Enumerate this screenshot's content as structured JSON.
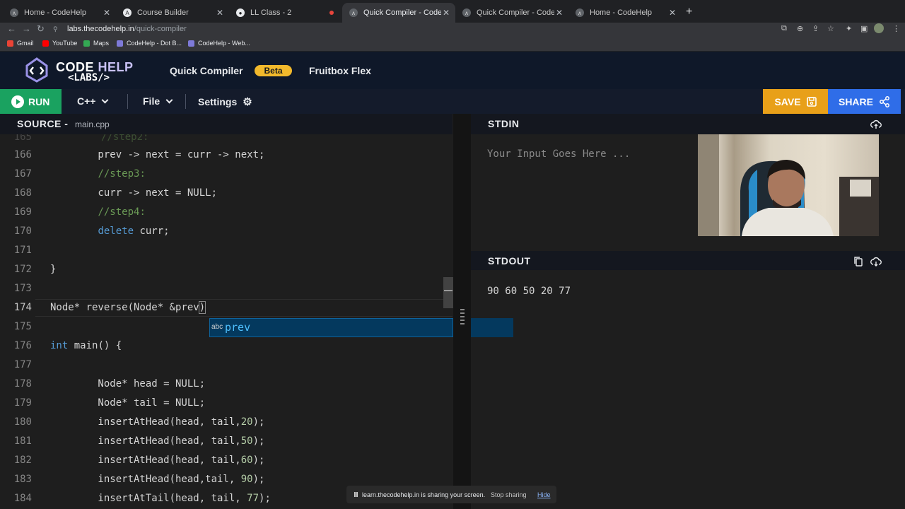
{
  "browser": {
    "tabs": [
      {
        "label": "Home - CodeHelp"
      },
      {
        "label": "Course Builder"
      },
      {
        "label": "LL Class - 2"
      },
      {
        "label": "Quick Compiler - CodeHelp La"
      },
      {
        "label": "Quick Compiler - CodeHelp La"
      },
      {
        "label": "Home - CodeHelp"
      }
    ],
    "url_host": "labs.thecodehelp.in",
    "url_path": "/quick-compiler",
    "bookmarks": [
      "Gmail",
      "YouTube",
      "Maps",
      "CodeHelp - Dot B...",
      "CodeHelp - Web..."
    ]
  },
  "header": {
    "logo_code": "CODE",
    "logo_help": "HELP",
    "logo_labs": "<LABS/>",
    "nav_quick_compiler": "Quick Compiler",
    "nav_beta": "Beta",
    "nav_fruitbox": "Fruitbox Flex"
  },
  "toolbar": {
    "run": "RUN",
    "language": "C++",
    "file": "File",
    "settings": "Settings",
    "save": "SAVE",
    "share": "SHARE"
  },
  "source": {
    "title": "SOURCE -",
    "filename": "main.cpp",
    "line_numbers": [
      "166",
      "167",
      "168",
      "169",
      "170",
      "171",
      "172",
      "173",
      "174",
      "175",
      "176",
      "177",
      "178",
      "179",
      "180",
      "181",
      "182",
      "183",
      "184"
    ],
    "current_line": "174",
    "autocomplete_kind": "abc",
    "autocomplete_word": "prev"
  },
  "stdin": {
    "title": "STDIN",
    "placeholder": "Your Input Goes Here ..."
  },
  "stdout": {
    "title": "STDOUT",
    "output": "90 60 50 20 77"
  },
  "share_bar": {
    "message": "learn.thecodehelp.in is sharing your screen.",
    "stop": "Stop sharing",
    "hide": "Hide"
  },
  "colors": {
    "run": "#1aa260",
    "save": "#e8a019",
    "share": "#2f6de8",
    "beta": "#f2b92c",
    "header_bg": "#0f1829"
  }
}
